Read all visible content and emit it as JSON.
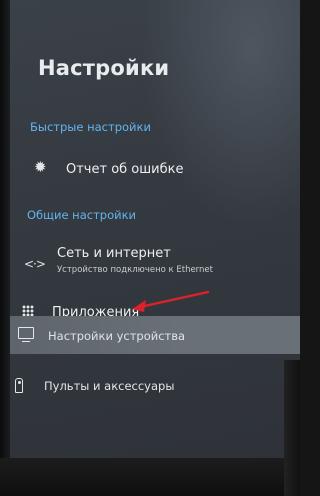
{
  "screen": {
    "title": "Настройки"
  },
  "sections": {
    "quick": "Быстрые настройки",
    "general": "Общие настройки"
  },
  "items": {
    "bug_report": {
      "label": "Отчет об ошибке",
      "icon": "bug-icon"
    },
    "network": {
      "label": "Сеть и интернет",
      "sublabel": "Устройство подключено к Ethernet",
      "icon": "network-icon"
    },
    "apps": {
      "label": "Приложения",
      "icon": "apps-grid-icon"
    },
    "device": {
      "label": "Настройки устройства",
      "icon": "tv-icon",
      "selected": true
    },
    "remotes": {
      "label": "Пульты и аксессуары",
      "icon": "remote-icon"
    }
  },
  "annotation": {
    "arrow_color": "#e0202a"
  },
  "colors": {
    "section_accent": "#63b4f0",
    "highlight": "#656c74"
  }
}
